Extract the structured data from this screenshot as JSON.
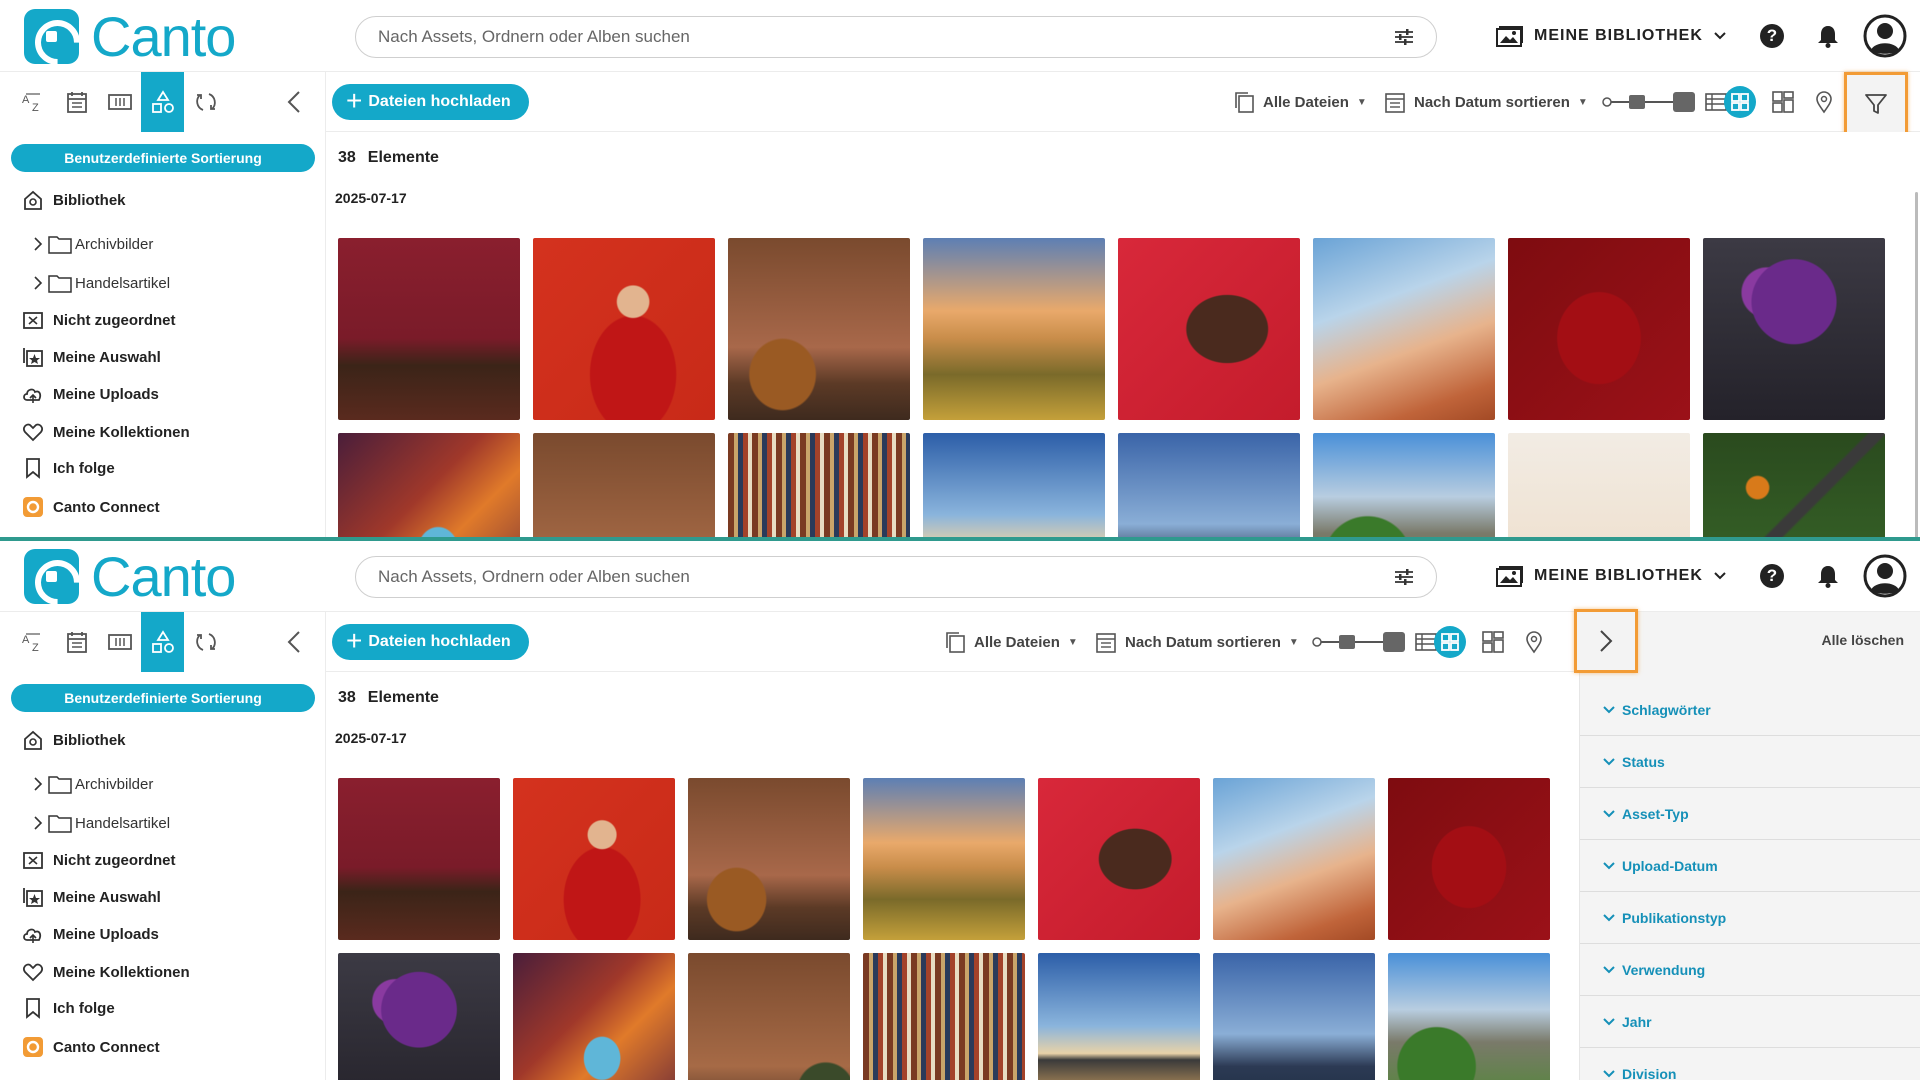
{
  "header": {
    "logo_text": "Canto",
    "search_placeholder": "Nach Assets, Ordnern oder Alben suchen",
    "library_label": "MEINE BIBLIOTHEK"
  },
  "sidebar": {
    "view_tabs": [
      "az-sort-icon",
      "calendar-icon",
      "folder-view-icon",
      "custom-tree-icon",
      "sync-icon"
    ],
    "sort_button": "Benutzerdefinierte Sortierung",
    "library": "Bibliothek",
    "folders": [
      "Archivbilder",
      "Handelsartikel"
    ],
    "items": [
      "Nicht zugeordnet",
      "Meine Auswahl",
      "Meine Uploads",
      "Meine Kollektionen",
      "Ich folge",
      "Canto Connect"
    ]
  },
  "toolbar": {
    "upload_label": "Dateien hochladen",
    "all_files": "Alle Dateien",
    "sort_by_date": "Nach Datum sortieren"
  },
  "content": {
    "count": "38",
    "count_label": "Elemente",
    "date_group": "2025-07-17"
  },
  "filter_panel": {
    "clear_all": "Alle löschen",
    "filters": [
      "Schlagwörter",
      "Status",
      "Asset-Typ",
      "Upload-Datum",
      "Publikationstyp",
      "Verwendung",
      "Jahr",
      "Division"
    ]
  },
  "colors": {
    "accent": "#14a8c9",
    "highlight": "#f29b35",
    "divider": "#2f9a8e"
  },
  "assets": [
    "living-room-red-wall",
    "woman-red-dress",
    "brown-room-chair",
    "balloons-valley-sunset",
    "woman-smiling-red",
    "canyon-hiker",
    "woman-red-suit",
    "purple-lilac-vase",
    "antelope-canyon",
    "brown-wall-plants",
    "library-bookshelves",
    "beach-rocks-sunset",
    "glass-buildings",
    "castle-garden",
    "balloons-city",
    "forest-aerial-road"
  ]
}
